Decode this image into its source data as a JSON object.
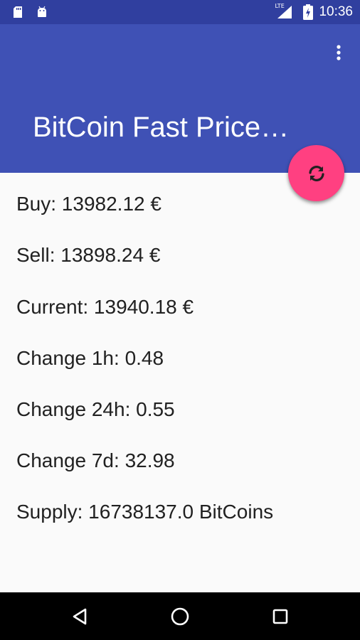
{
  "status_bar": {
    "time": "10:36",
    "network_label": "LTE",
    "icons": [
      "sd-card-icon",
      "android-icon",
      "lte-signal-icon",
      "battery-charging-icon"
    ]
  },
  "app_bar": {
    "title": "BitCoin Fast Price…",
    "menu_icon": "overflow-menu-icon"
  },
  "fab": {
    "icon": "refresh-icon"
  },
  "prices": [
    "Buy: 13982.12 €",
    "Sell: 13898.24 €",
    "Current: 13940.18 €",
    "Change 1h: 0.48",
    "Change 24h: 0.55",
    "Change 7d: 32.98",
    "Supply: 16738137.0 BitCoins"
  ],
  "nav_bar": {
    "icons": [
      "back-icon",
      "home-icon",
      "recents-icon"
    ]
  },
  "colors": {
    "primary": "#3f51b5",
    "primary_dark": "#303f9f",
    "accent": "#ff4081",
    "background": "#fafafa",
    "text": "#212121"
  }
}
